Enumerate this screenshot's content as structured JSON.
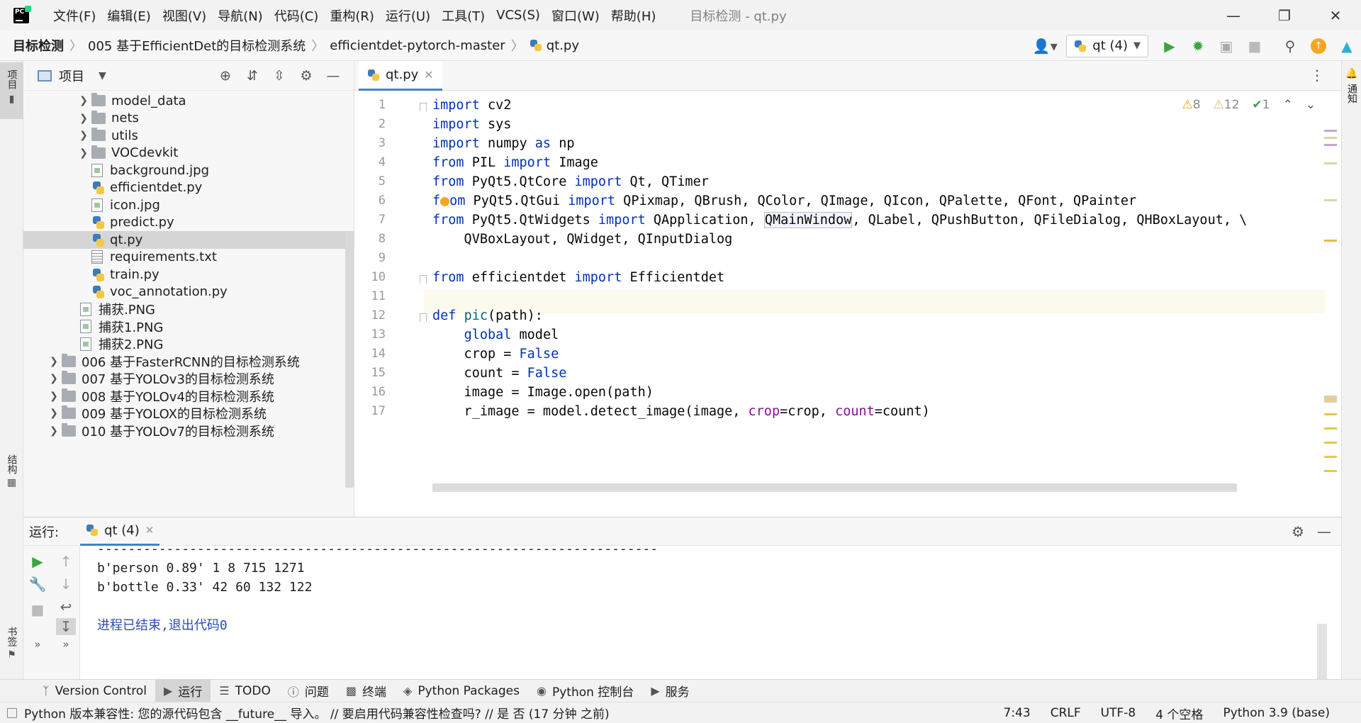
{
  "menu": {
    "items": [
      "文件(F)",
      "编辑(E)",
      "视图(V)",
      "导航(N)",
      "代码(C)",
      "重构(R)",
      "运行(U)",
      "工具(T)",
      "VCS(S)",
      "窗口(W)",
      "帮助(H)"
    ],
    "window_title": "目标检测 - qt.py"
  },
  "breadcrumb": [
    "目标检测",
    "005 基于EfficientDet的目标检测系统",
    "efficientdet-pytorch-master",
    "qt.py"
  ],
  "run_config": "qt (4)",
  "left_strip": {
    "project": "项目",
    "structure": "结构",
    "bookmarks": "书签"
  },
  "right_strip": {
    "notifications": "通知"
  },
  "project": {
    "title": "项目",
    "tree": [
      {
        "label": "model_data",
        "kind": "folder",
        "indent": 2,
        "arrow": true,
        "selected": false
      },
      {
        "label": "nets",
        "kind": "folder",
        "indent": 2,
        "arrow": true,
        "selected": false
      },
      {
        "label": "utils",
        "kind": "folder",
        "indent": 2,
        "arrow": true,
        "selected": false
      },
      {
        "label": "VOCdevkit",
        "kind": "folder",
        "indent": 2,
        "arrow": true,
        "selected": false
      },
      {
        "label": "background.jpg",
        "kind": "image",
        "indent": 2,
        "arrow": false,
        "selected": false
      },
      {
        "label": "efficientdet.py",
        "kind": "python",
        "indent": 2,
        "arrow": false,
        "selected": false
      },
      {
        "label": "icon.jpg",
        "kind": "image",
        "indent": 2,
        "arrow": false,
        "selected": false
      },
      {
        "label": "predict.py",
        "kind": "python",
        "indent": 2,
        "arrow": false,
        "selected": false
      },
      {
        "label": "qt.py",
        "kind": "python",
        "indent": 2,
        "arrow": false,
        "selected": true
      },
      {
        "label": "requirements.txt",
        "kind": "text",
        "indent": 2,
        "arrow": false,
        "selected": false
      },
      {
        "label": "train.py",
        "kind": "python",
        "indent": 2,
        "arrow": false,
        "selected": false
      },
      {
        "label": "voc_annotation.py",
        "kind": "python",
        "indent": 2,
        "arrow": false,
        "selected": false
      },
      {
        "label": "捕获.PNG",
        "kind": "image",
        "indent": 1,
        "arrow": false,
        "selected": false
      },
      {
        "label": "捕获1.PNG",
        "kind": "image",
        "indent": 1,
        "arrow": false,
        "selected": false
      },
      {
        "label": "捕获2.PNG",
        "kind": "image",
        "indent": 1,
        "arrow": false,
        "selected": false
      },
      {
        "label": "006 基于FasterRCNN的目标检测系统",
        "kind": "folder",
        "indent": 0,
        "arrow": true,
        "selected": false
      },
      {
        "label": "007 基于YOLOv3的目标检测系统",
        "kind": "folder",
        "indent": 0,
        "arrow": true,
        "selected": false
      },
      {
        "label": "008 基于YOLOv4的目标检测系统",
        "kind": "folder",
        "indent": 0,
        "arrow": true,
        "selected": false
      },
      {
        "label": "009 基于YOLOX的目标检测系统",
        "kind": "folder",
        "indent": 0,
        "arrow": true,
        "selected": false
      },
      {
        "label": "010 基于YOLOv7的目标检测系统",
        "kind": "folder",
        "indent": 0,
        "arrow": true,
        "selected": false
      }
    ]
  },
  "editor": {
    "tab": "qt.py",
    "inspections": {
      "warnings": "8",
      "weak_warnings": "12",
      "typos": "1"
    },
    "line_numbers": [
      "1",
      "2",
      "3",
      "4",
      "5",
      "6",
      "7",
      "8",
      "9",
      "10",
      "11",
      "12",
      "13",
      "14",
      "15",
      "16",
      "17"
    ],
    "code": [
      [
        {
          "t": "import",
          "c": "kw"
        },
        {
          "t": " cv2",
          "c": ""
        }
      ],
      [
        {
          "t": "import",
          "c": "kw"
        },
        {
          "t": " sys",
          "c": ""
        }
      ],
      [
        {
          "t": "import",
          "c": "kw"
        },
        {
          "t": " numpy ",
          "c": ""
        },
        {
          "t": "as",
          "c": "kw"
        },
        {
          "t": " np",
          "c": ""
        }
      ],
      [
        {
          "t": "from",
          "c": "kw"
        },
        {
          "t": " PIL ",
          "c": ""
        },
        {
          "t": "import",
          "c": "kw"
        },
        {
          "t": " Image",
          "c": ""
        }
      ],
      [
        {
          "t": "from",
          "c": "kw"
        },
        {
          "t": " PyQt5.QtCore ",
          "c": ""
        },
        {
          "t": "import",
          "c": "kw"
        },
        {
          "t": " Qt, QTimer",
          "c": ""
        }
      ],
      [
        {
          "t": "f",
          "c": "kw"
        },
        {
          "t": "bulb",
          "c": "bulb"
        },
        {
          "t": "om",
          "c": "kw"
        },
        {
          "t": " PyQt5.QtGui ",
          "c": ""
        },
        {
          "t": "import",
          "c": "kw"
        },
        {
          "t": " QPixmap, QBrush, QColor, QImage, QIcon, QPalette, QFont, QPainter",
          "c": ""
        }
      ],
      [
        {
          "t": "from",
          "c": "kw"
        },
        {
          "t": " PyQt5.QtWidgets ",
          "c": ""
        },
        {
          "t": "import",
          "c": "kw"
        },
        {
          "t": " QApplication, ",
          "c": ""
        },
        {
          "t": "QMainWindow",
          "c": "caret-box"
        },
        {
          "t": ", QLabel, QPushButton, QFileDialog, QHBoxLayout, \\",
          "c": ""
        }
      ],
      [
        {
          "t": "    QVBoxLayout, QWidget, QInputDialog",
          "c": ""
        }
      ],
      [],
      [
        {
          "t": "from",
          "c": "kw"
        },
        {
          "t": " efficientdet ",
          "c": ""
        },
        {
          "t": "import",
          "c": "kw"
        },
        {
          "t": " Efficientdet",
          "c": ""
        }
      ],
      [],
      [
        {
          "t": "def",
          "c": "kw"
        },
        {
          "t": " ",
          "c": ""
        },
        {
          "t": "pic",
          "c": "fn"
        },
        {
          "t": "(path):",
          "c": ""
        }
      ],
      [
        {
          "t": "    ",
          "c": ""
        },
        {
          "t": "global",
          "c": "kw"
        },
        {
          "t": " model",
          "c": ""
        }
      ],
      [
        {
          "t": "    crop = ",
          "c": ""
        },
        {
          "t": "False",
          "c": "kw"
        }
      ],
      [
        {
          "t": "    count = ",
          "c": ""
        },
        {
          "t": "False",
          "c": "kw"
        }
      ],
      [
        {
          "t": "    image = Image.open(path)",
          "c": ""
        }
      ],
      [
        {
          "t": "    r_image = model.detect_image(image, ",
          "c": ""
        },
        {
          "t": "crop",
          "c": "param"
        },
        {
          "t": "=crop, ",
          "c": ""
        },
        {
          "t": "count",
          "c": "param"
        },
        {
          "t": "=count)",
          "c": ""
        }
      ]
    ]
  },
  "run": {
    "label": "运行:",
    "tab": "qt (4)",
    "console": [
      "-------------------------------------------------------------------------",
      "b'person 0.89' 1 8 715 1271",
      "b'bottle 0.33' 42 60 132 122",
      "",
      "进程已结束,退出代码0"
    ]
  },
  "toolwindows": [
    "Version Control",
    "运行",
    "TODO",
    "问题",
    "终端",
    "Python Packages",
    "Python 控制台",
    "服务"
  ],
  "status": {
    "message": "Python 版本兼容性: 您的源代码包含 __future__ 导入。 // 要启用代码兼容性检查吗? // 是  否 (17 分钟 之前)",
    "position": "7:43",
    "line_sep": "CRLF",
    "encoding": "UTF-8",
    "indent": "4 个空格",
    "interpreter": "Python 3.9 (base)"
  }
}
